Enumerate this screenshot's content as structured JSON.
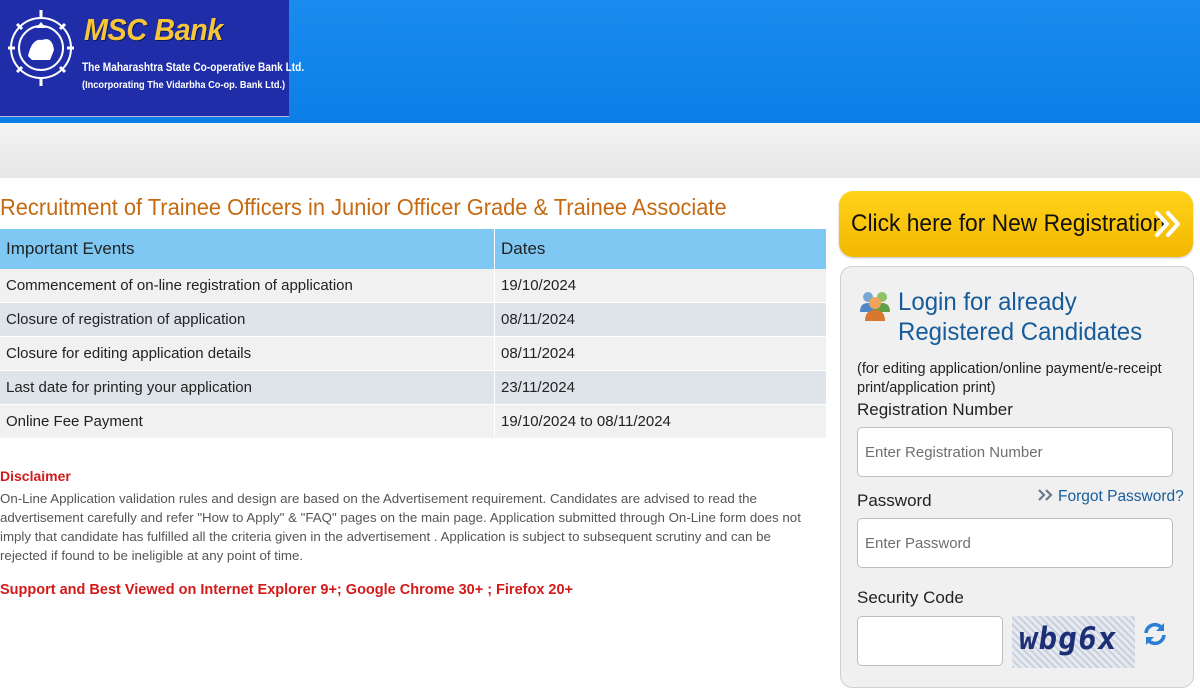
{
  "header": {
    "brand": "MSC Bank",
    "bank_name": "The Maharashtra State Co-operative Bank Ltd.",
    "bank_subtitle": "(Incorporating The Vidarbha Co-op. Bank Ltd.)",
    "emblem_icon": "bank-emblem-icon"
  },
  "main": {
    "title": "Recruitment of Trainee Officers in Junior Officer Grade & Trainee Associate",
    "table": {
      "headers": [
        "Important Events",
        "Dates"
      ],
      "rows": [
        [
          "Commencement of on-line registration of application",
          "19/10/2024"
        ],
        [
          "Closure of registration of application",
          "08/11/2024"
        ],
        [
          "Closure for editing application details",
          "08/11/2024"
        ],
        [
          "Last date for printing your application",
          "23/11/2024"
        ],
        [
          "Online Fee Payment",
          "19/10/2024 to 08/11/2024"
        ]
      ]
    },
    "disclaimer_title": "Disclaimer",
    "disclaimer_text": "On-Line Application validation rules and design are based on the Advertisement requirement. Candidates are advised to read the advertisement carefully and refer \"How to Apply\" & \"FAQ\" pages on the main page. Application submitted through On-Line form does not imply that candidate has fulfilled all the criteria given in the advertisement . Application is subject to subsequent scrutiny and can be rejected if found to be ineligible at any point of time.",
    "support_text": "Support and Best Viewed on Internet Explorer 9+; Google Chrome 30+ ; Firefox 20+"
  },
  "sidebar": {
    "new_registration_label": "Click here for New Registration",
    "login_title_line1": "Login for already",
    "login_title_line2": "Registered Candidates",
    "login_note": "(for editing application/online payment/e-receipt print/application print)",
    "registration_label": "Registration Number",
    "registration_placeholder": "Enter Registration Number",
    "registration_value": "",
    "password_label": "Password",
    "password_placeholder": "Enter Password",
    "password_value": "",
    "forgot_label": "Forgot Password?",
    "security_label": "Security Code",
    "security_value": "",
    "captcha_text": "wbg6x"
  },
  "colors": {
    "header_blue": "#0b7fe6",
    "logo_navy": "#1f2ea8",
    "brand_gold": "#f6c63a",
    "title_orange": "#c66a12",
    "table_header": "#7ec8f3",
    "disclaimer_red": "#d21a1a",
    "button_yellow": "#ffc400",
    "link_blue": "#175c9a"
  },
  "icons": [
    "bank-emblem-icon",
    "double-chevron-right-icon",
    "users-icon",
    "double-chevron-icon",
    "refresh-icon"
  ]
}
